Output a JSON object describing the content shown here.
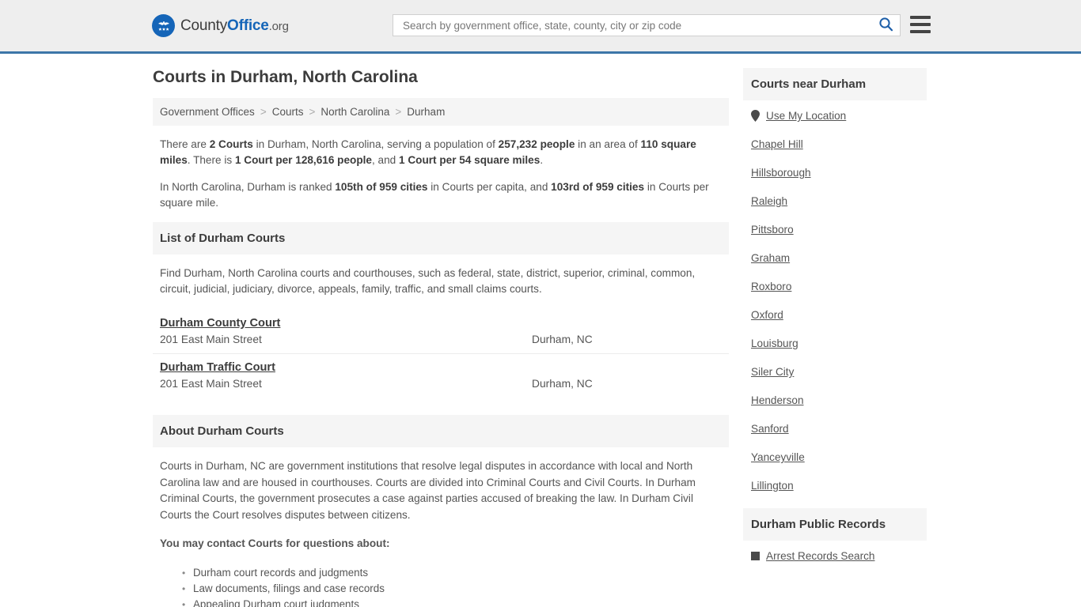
{
  "header": {
    "logo": {
      "part1": "County",
      "part2": "Office",
      "tld": ".org",
      "icon": "eagle-seal-icon"
    },
    "search": {
      "placeholder": "Search by government office, state, county, city or zip code",
      "value": "",
      "icon": "search-icon"
    },
    "menu": {
      "icon": "hamburger-menu-icon"
    },
    "accent_color": "#3d76a8"
  },
  "page": {
    "title": "Courts in Durham, North Carolina"
  },
  "breadcrumb": {
    "items": [
      {
        "label": "Government Offices"
      },
      {
        "label": "Courts"
      },
      {
        "label": "North Carolina"
      },
      {
        "label": "Durham"
      }
    ],
    "separator": ">"
  },
  "intro": {
    "p1": {
      "t1": "There are ",
      "b1": "2 Courts",
      "t2": " in Durham, North Carolina, serving a population of ",
      "b2": "257,232 people",
      "t3": " in an area of ",
      "b3": "110 square miles",
      "t4": ". There is ",
      "b4": "1 Court per 128,616 people",
      "t5": ", and ",
      "b5": "1 Court per 54 square miles",
      "t6": "."
    },
    "p2": {
      "t1": "In North Carolina, Durham is ranked ",
      "b1": "105th of 959 cities",
      "t2": " in Courts per capita, and ",
      "b2": "103rd of 959 cities",
      "t3": " in Courts per square mile."
    }
  },
  "list_section": {
    "heading": "List of Durham Courts",
    "description": "Find Durham, North Carolina courts and courthouses, such as federal, state, district, superior, criminal, common, circuit, judicial, judiciary, divorce, appeals, family, traffic, and small claims courts.",
    "courts": [
      {
        "name": "Durham County Court",
        "address": "201 East Main Street",
        "city": "Durham, NC"
      },
      {
        "name": "Durham Traffic Court",
        "address": "201 East Main Street",
        "city": "Durham, NC"
      }
    ]
  },
  "about_section": {
    "heading": "About Durham Courts",
    "paragraph": "Courts in Durham, NC are government institutions that resolve legal disputes in accordance with local and North Carolina law and are housed in courthouses. Courts are divided into Criminal Courts and Civil Courts. In Durham Criminal Courts, the government prosecutes a case against parties accused of breaking the law. In Durham Civil Courts the Court resolves disputes between citizens.",
    "contact_lead": "You may contact Courts for questions about:",
    "contact_items": [
      "Durham court records and judgments",
      "Law documents, filings and case records",
      "Appealing Durham court judgments"
    ]
  },
  "sidebar": {
    "nearby": {
      "heading": "Courts near Durham",
      "use_my_location": {
        "label": "Use My Location",
        "icon": "map-pin-icon"
      },
      "cities": [
        "Chapel Hill",
        "Hillsborough",
        "Raleigh",
        "Pittsboro",
        "Graham",
        "Roxboro",
        "Oxford",
        "Louisburg",
        "Siler City",
        "Henderson",
        "Sanford",
        "Yanceyville",
        "Lillington"
      ]
    },
    "public_records": {
      "heading": "Durham Public Records",
      "links": [
        {
          "label": "Arrest Records Search",
          "icon": "square-bullet-icon"
        }
      ]
    }
  }
}
